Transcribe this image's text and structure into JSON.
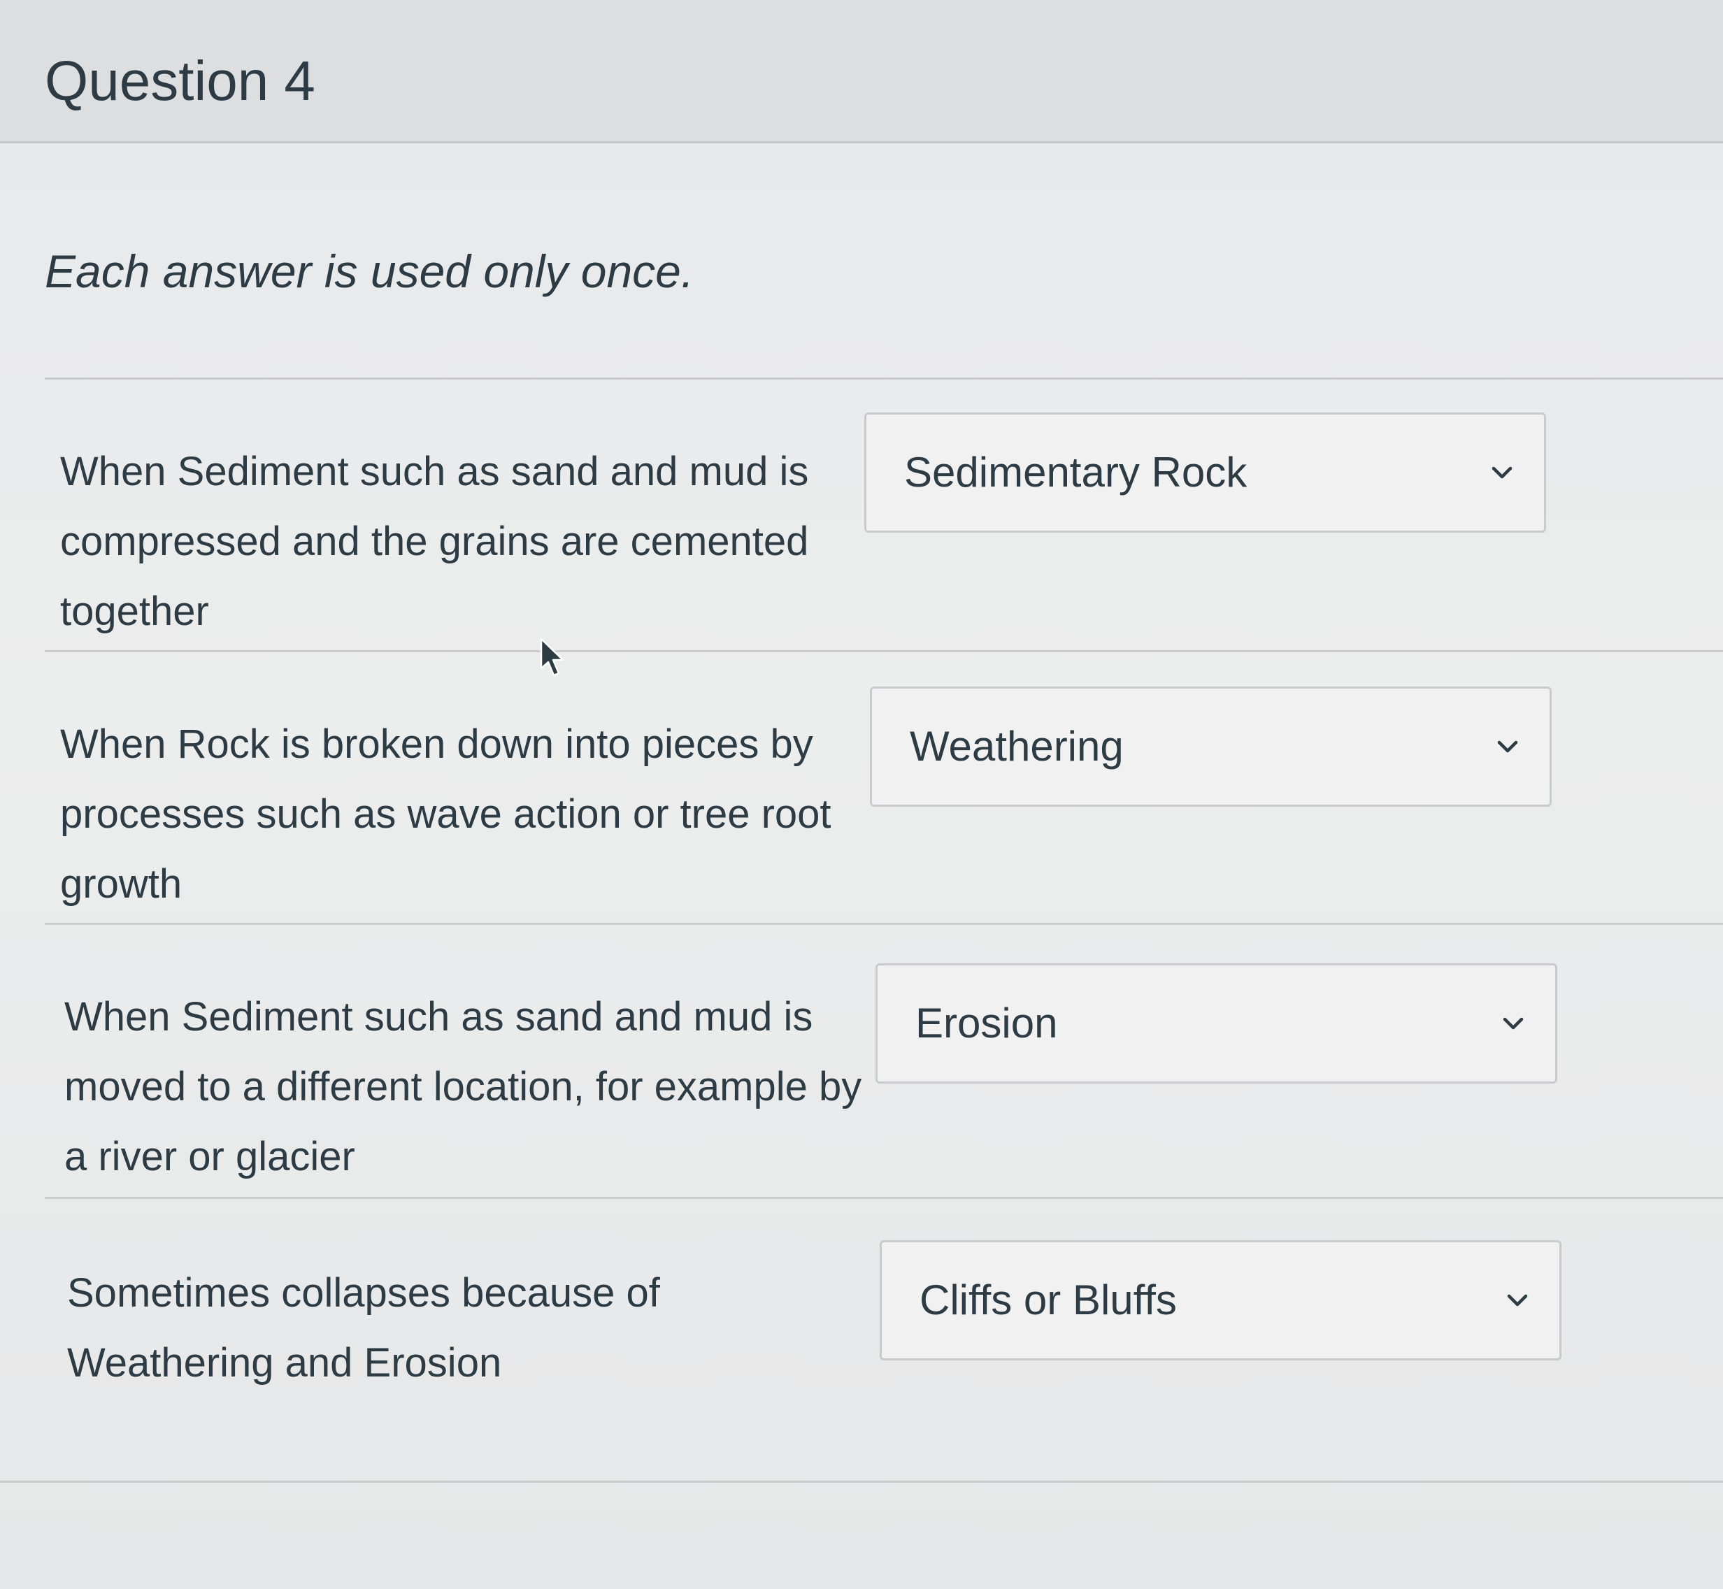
{
  "question": {
    "title": "Question 4",
    "instructions": "Each answer is used only once."
  },
  "rows": [
    {
      "prompt": "When Sediment such as sand and mud is compressed and the grains are cemented together",
      "selected": "Sedimentary Rock"
    },
    {
      "prompt": "When Rock is broken down into pieces by processes such as wave action or tree root growth",
      "selected": "Weathering"
    },
    {
      "prompt": "When Sediment such as sand and mud is moved to a different location, for example by a river or glacier",
      "selected": "Erosion"
    },
    {
      "prompt": "Sometimes collapses because of Weathering and Erosion",
      "selected": "Cliffs or Bluffs"
    }
  ],
  "icons": {
    "dropdown": "chevron-down-icon",
    "cursor": "mouse-pointer-icon"
  },
  "colors": {
    "text": "#2d3b45",
    "border": "#c7cbcf",
    "header_bg": "#dcdee0"
  }
}
